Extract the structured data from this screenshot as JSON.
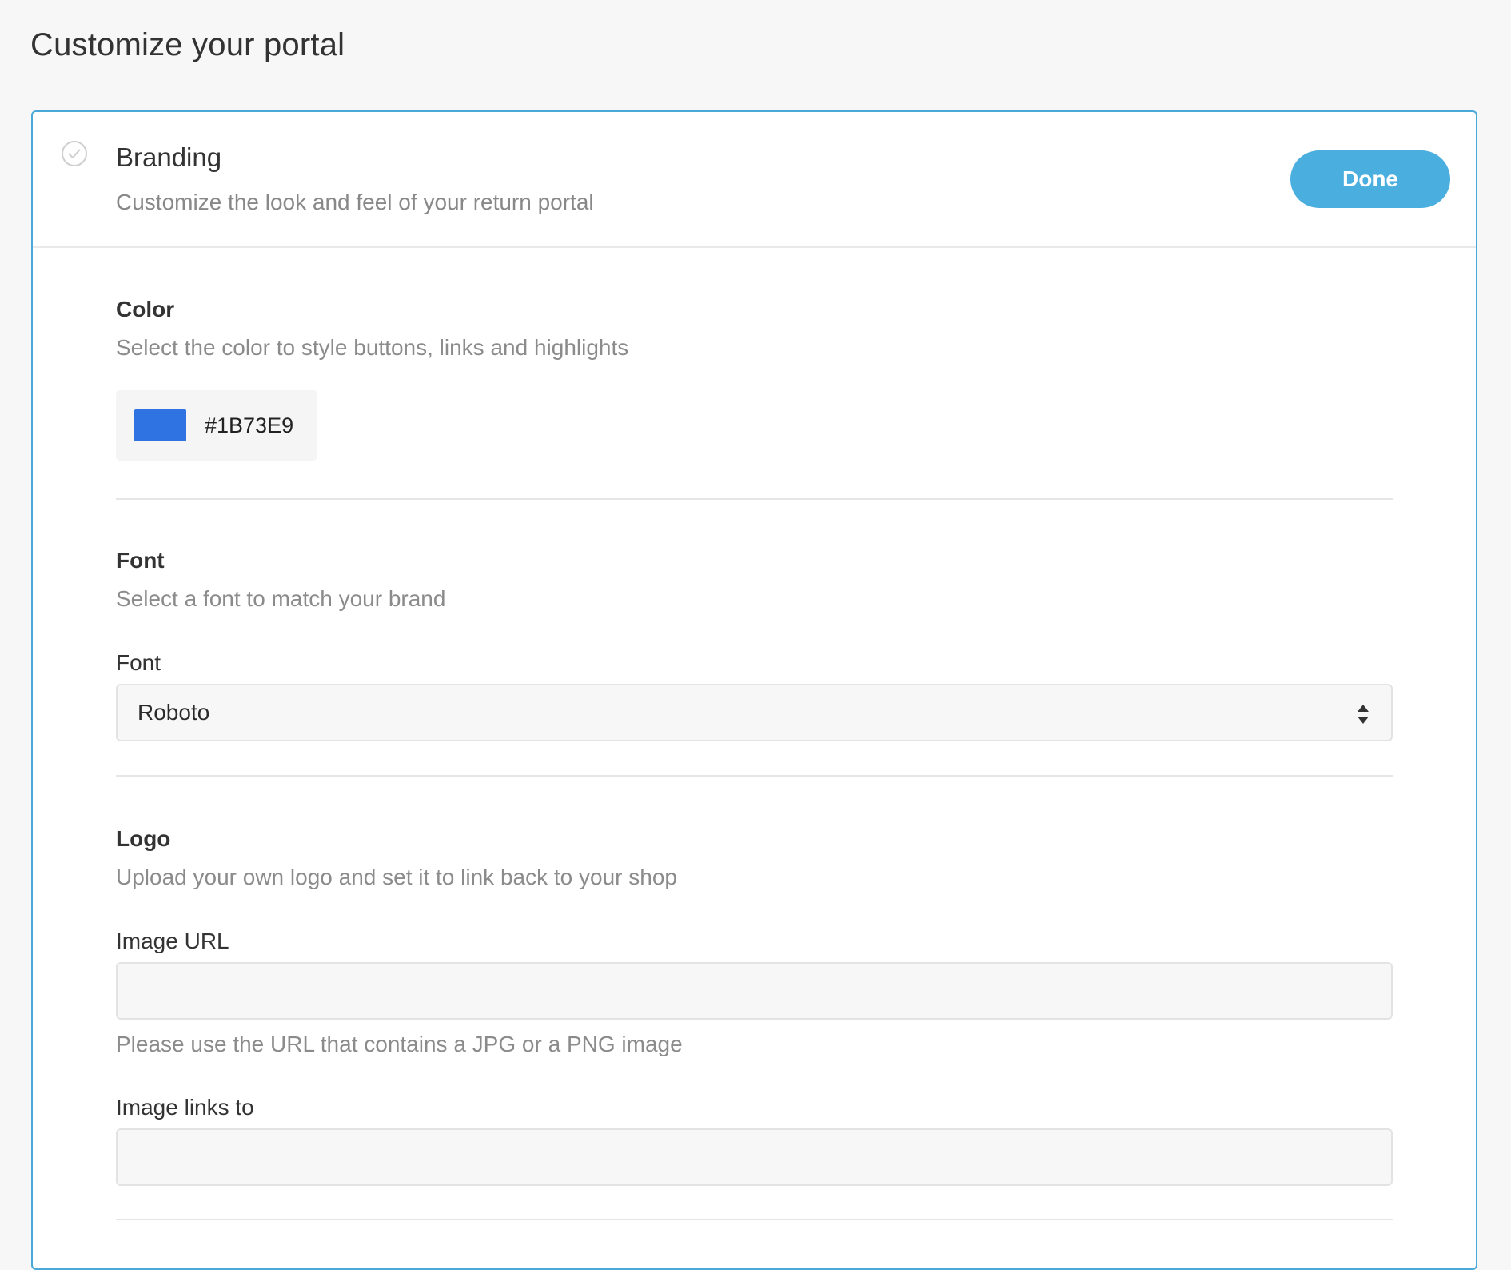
{
  "page": {
    "title": "Customize your portal"
  },
  "card": {
    "title": "Branding",
    "subtitle": "Customize the look and feel of your return portal",
    "done_label": "Done"
  },
  "color_section": {
    "title": "Color",
    "description": "Select the color to style buttons, links and highlights",
    "value": "#1B73E9",
    "swatch_color": "#2f73e3"
  },
  "font_section": {
    "title": "Font",
    "description": "Select a font to match your brand",
    "field_label": "Font",
    "selected": "Roboto"
  },
  "logo_section": {
    "title": "Logo",
    "description": "Upload your own logo and set it to link back to your shop",
    "image_url_label": "Image URL",
    "image_url_value": "",
    "image_url_help": "Please use the URL that contains a JPG or a PNG image",
    "image_links_label": "Image links to",
    "image_links_value": ""
  },
  "icons": {
    "header_check": "check-circle-icon",
    "select_arrows": "sort-arrows-icon"
  },
  "colors": {
    "card_border": "#4aa9d8",
    "done_button": "#4aaede"
  }
}
